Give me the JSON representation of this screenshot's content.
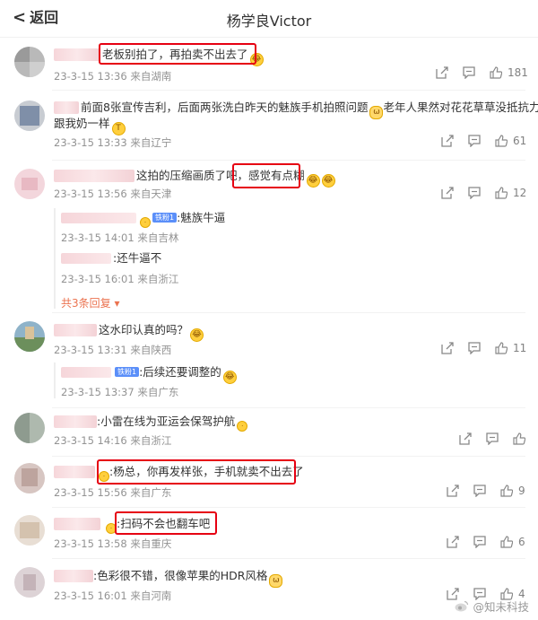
{
  "header": {
    "back_label": "返回",
    "title": "杨学良Victor"
  },
  "comments": [
    {
      "text": "老板别拍了，再拍卖不出去了",
      "time": "23-3-15 13:36",
      "location": "来自湖南",
      "likes": "181"
    },
    {
      "text1": "前面8张宣传吉利，后面两张洗白昨天的魅族手机拍照问题",
      "text1b": "老年人果然对花花草草没抵抗力",
      "text2": "跟我奶一样",
      "time": "23-3-15 13:33",
      "location": "来自辽宁",
      "likes": "61"
    },
    {
      "text": "这拍的压缩画质了吧，感觉有点糊",
      "time": "23-3-15 13:56",
      "location": "来自天津",
      "likes": "12",
      "replies": [
        {
          "badge": "铁粉1",
          "text": ":魅族牛逼",
          "time": "23-3-15 14:01",
          "location": "来自吉林"
        },
        {
          "text": ":还牛逼不",
          "time": "23-3-15 16:01",
          "location": "来自浙江"
        }
      ],
      "more": "共3条回复"
    },
    {
      "text": "这水印认真的吗？",
      "time": "23-3-15 13:31",
      "location": "来自陕西",
      "likes": "11",
      "replies": [
        {
          "badge": "铁粉1",
          "text": ":后续还要调整的",
          "time": "23-3-15 13:37",
          "location": "来自广东"
        }
      ]
    },
    {
      "text": ":小雷在线为亚运会保驾护航",
      "time": "23-3-15 14:16",
      "location": "来自浙江",
      "likes": ""
    },
    {
      "text": ":杨总，你再发样张，手机就卖不出去了",
      "time": "23-3-15 15:56",
      "location": "来自广东",
      "likes": "9"
    },
    {
      "text": ":扫码不会也翻车吧",
      "time": "23-3-15 13:58",
      "location": "来自重庆",
      "likes": "6"
    },
    {
      "text": ":色彩很不错，很像苹果的HDR风格",
      "time": "23-3-15 16:01",
      "location": "来自河南",
      "likes": "4"
    }
  ],
  "watermark": "@知未科技",
  "colors": {
    "highlight": "#e60012",
    "link": "#eb7350",
    "meta": "#939393"
  }
}
